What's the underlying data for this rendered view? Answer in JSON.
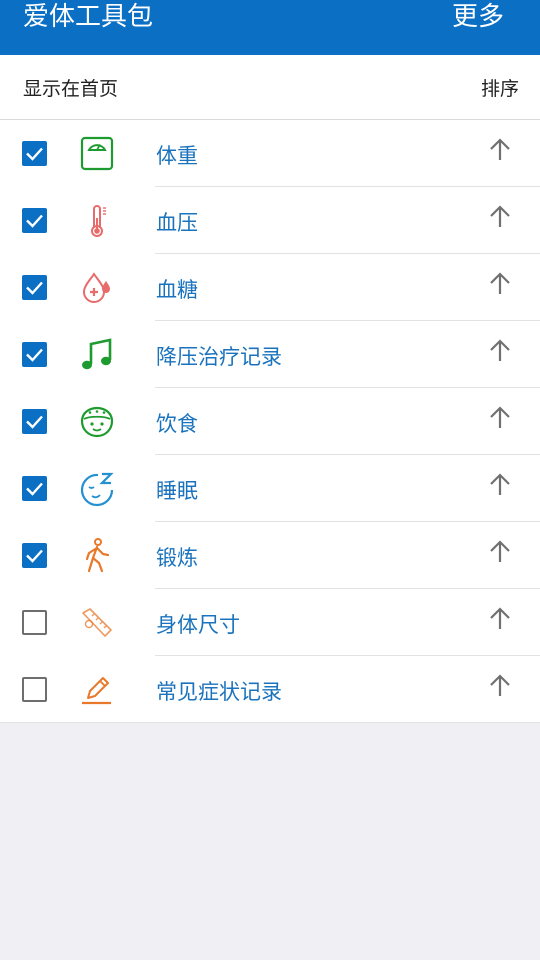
{
  "header": {
    "title": "爱体工具包",
    "more_label": "更多"
  },
  "subheader": {
    "left_label": "显示在首页",
    "right_label": "排序"
  },
  "colors": {
    "accent": "#0b6fc4",
    "label": "#1b73bd",
    "green_icon": "#1e9b2f",
    "red_icon": "#e86b6b",
    "orange_icon": "#e8782a",
    "blue_icon": "#2390d2"
  },
  "tools": [
    {
      "label": "体重",
      "checked": true,
      "icon": "scale-icon"
    },
    {
      "label": "血压",
      "checked": true,
      "icon": "thermometer-icon"
    },
    {
      "label": "血糖",
      "checked": true,
      "icon": "blood-drop-icon"
    },
    {
      "label": "降压治疗记录",
      "checked": true,
      "icon": "music-note-icon"
    },
    {
      "label": "饮食",
      "checked": true,
      "icon": "food-bowl-icon"
    },
    {
      "label": "睡眠",
      "checked": true,
      "icon": "sleep-face-icon"
    },
    {
      "label": "锻炼",
      "checked": true,
      "icon": "walking-person-icon"
    },
    {
      "label": "身体尺寸",
      "checked": false,
      "icon": "measuring-tape-icon"
    },
    {
      "label": "常见症状记录",
      "checked": false,
      "icon": "pencil-icon"
    }
  ]
}
